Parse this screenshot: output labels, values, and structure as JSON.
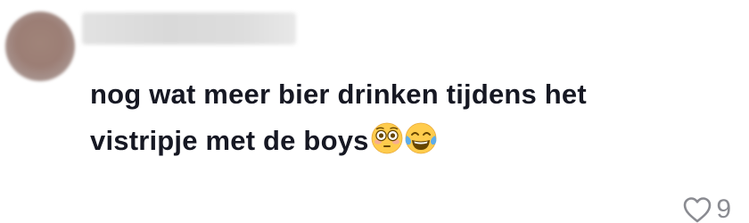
{
  "comment": {
    "avatar_icon": "blurred-avatar",
    "username_icon": "blurred-username",
    "text": "nog wat meer bier drinken tijdens het vistripje met de boys",
    "emojis": [
      "flushed-face-emoji",
      "face-with-tears-of-joy-emoji"
    ],
    "like_icon": "heart-outline-icon",
    "like_count": "9"
  },
  "colors": {
    "text": "#161823",
    "muted": "#8a8b91"
  }
}
